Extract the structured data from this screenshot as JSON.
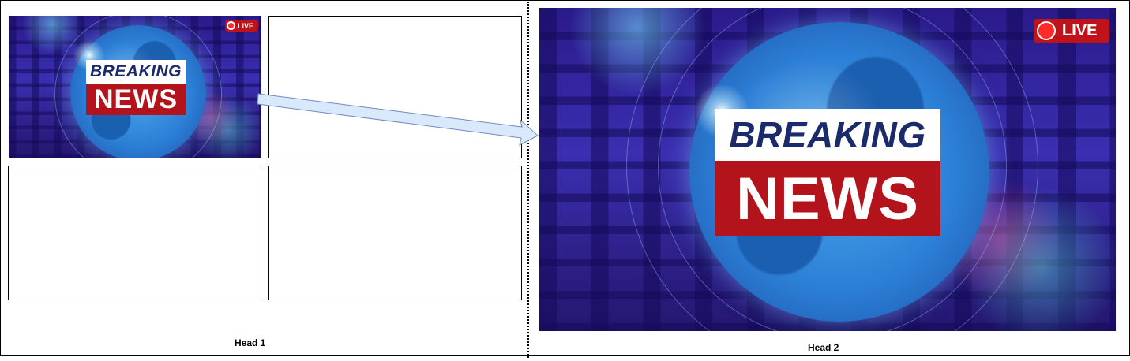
{
  "heads": [
    {
      "caption": "Head 1"
    },
    {
      "caption": "Head 2"
    }
  ],
  "news_image": {
    "headline_top": "BREAKING",
    "headline_bottom": "NEWS",
    "live_badge": "LIVE",
    "colors": {
      "top_banner_bg": "#ffffff",
      "top_banner_text": "#1b2a6b",
      "bottom_banner_bg": "#b3131b",
      "bottom_banner_text": "#ffffff",
      "live_bg": "#c0121a"
    }
  },
  "connector": {
    "fill": "#dae8fc",
    "stroke": "#6c8ebf"
  }
}
